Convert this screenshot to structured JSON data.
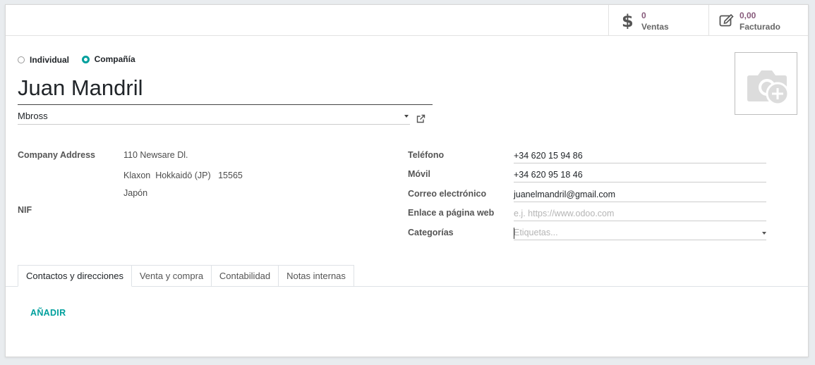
{
  "stats": {
    "sales": {
      "value": "0",
      "label": "Ventas",
      "icon": "dollar-icon"
    },
    "invoiced": {
      "value": "0,00",
      "label": "Facturado",
      "icon": "edit-icon"
    }
  },
  "type": {
    "individual": "Individual",
    "company": "Compañía",
    "selected": "company"
  },
  "partner": {
    "name": "Juan Mandril",
    "parent_company": "Mbross"
  },
  "address": {
    "label": "Company Address",
    "street": "110 Newsare Dl.",
    "city": "Klaxon",
    "state": "Hokkaidō (JP)",
    "zip": "15565",
    "country": "Japón"
  },
  "vat": {
    "label": "NIF",
    "value": ""
  },
  "contact": {
    "phone_label": "Teléfono",
    "phone": "+34 620 15 94 86",
    "mobile_label": "Móvil",
    "mobile": "+34 620 95 18 46",
    "email_label": "Correo electrónico",
    "email": "juanelmandril@gmail.com",
    "website_label": "Enlace a página web",
    "website_placeholder": "e.j. https://www.odoo.com",
    "tags_label": "Categorías",
    "tags_placeholder": "Etiquetas..."
  },
  "tabs": [
    {
      "label": "Contactos y direcciones",
      "active": true
    },
    {
      "label": "Venta y compra",
      "active": false
    },
    {
      "label": "Contabilidad",
      "active": false
    },
    {
      "label": "Notas internas",
      "active": false
    }
  ],
  "add_label": "AÑADIR",
  "colors": {
    "accent": "#00a09d",
    "stat": "#875a7b"
  }
}
